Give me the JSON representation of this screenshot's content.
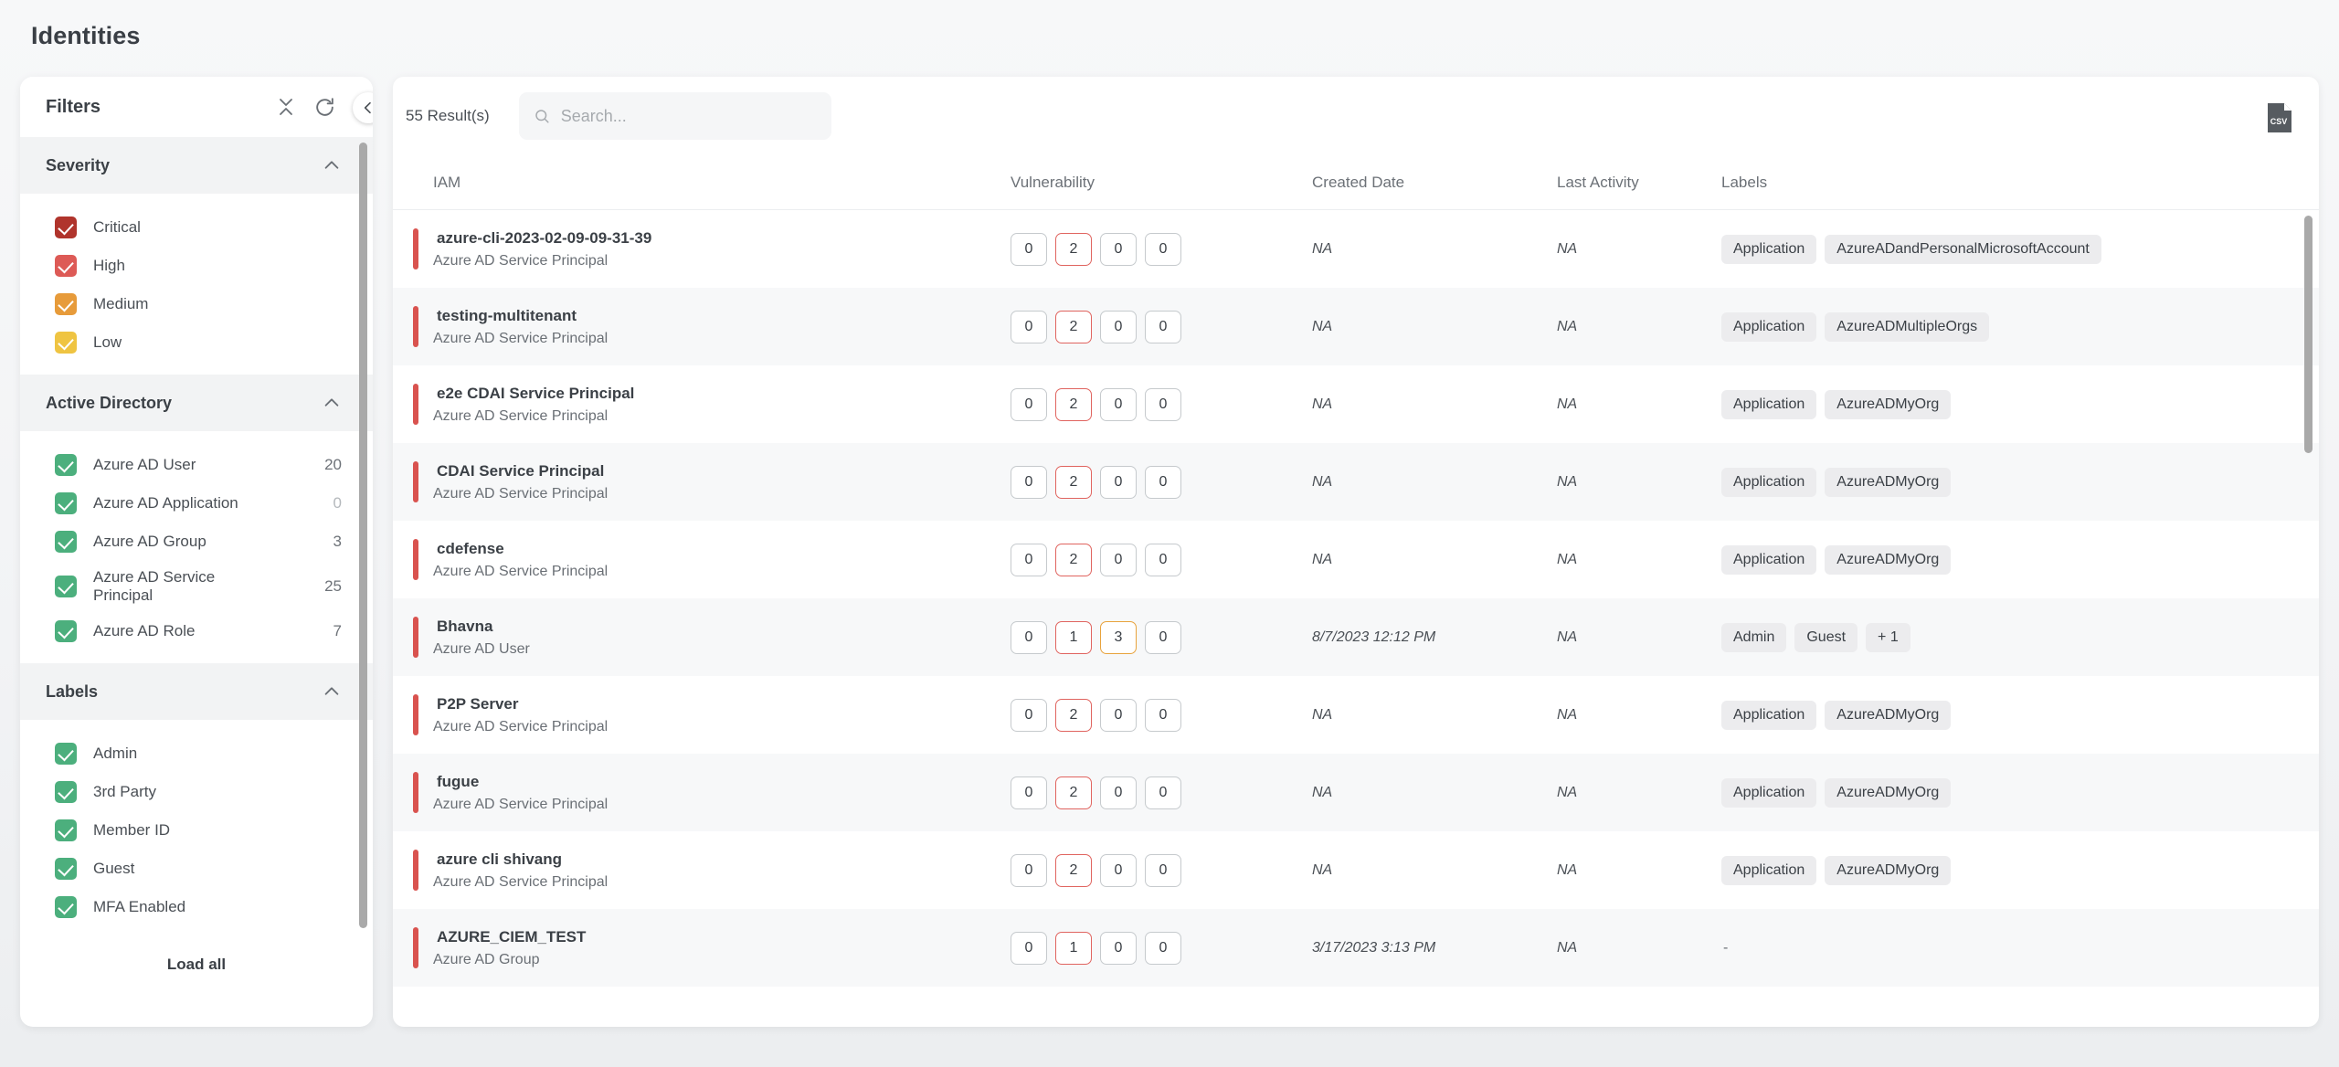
{
  "page": {
    "title": "Identities"
  },
  "sidebar": {
    "title": "Filters",
    "icons": {
      "collapse_all": "collapse-all-icon",
      "reset": "refresh-icon",
      "panel_toggle": "chevron-left-icon"
    },
    "load_all_label": "Load all",
    "groups": [
      {
        "name": "Severity",
        "items": [
          {
            "label": "Critical",
            "color": "#b0342c",
            "checked": true,
            "count": ""
          },
          {
            "label": "High",
            "color": "#dd5a56",
            "checked": true,
            "count": ""
          },
          {
            "label": "Medium",
            "color": "#e79b3a",
            "checked": true,
            "count": ""
          },
          {
            "label": "Low",
            "color": "#efc442",
            "checked": true,
            "count": ""
          }
        ]
      },
      {
        "name": "Active Directory",
        "items": [
          {
            "label": "Azure AD User",
            "color": "#4caf7d",
            "checked": true,
            "count": "20"
          },
          {
            "label": "Azure AD Application",
            "color": "#4caf7d",
            "checked": true,
            "count": "0"
          },
          {
            "label": "Azure AD Group",
            "color": "#4caf7d",
            "checked": true,
            "count": "3"
          },
          {
            "label": "Azure AD Service Principal",
            "color": "#4caf7d",
            "checked": true,
            "count": "25"
          },
          {
            "label": "Azure AD Role",
            "color": "#4caf7d",
            "checked": true,
            "count": "7"
          }
        ]
      },
      {
        "name": "Labels",
        "items": [
          {
            "label": "Admin",
            "color": "#4caf7d",
            "checked": true,
            "count": ""
          },
          {
            "label": "3rd Party",
            "color": "#4caf7d",
            "checked": true,
            "count": ""
          },
          {
            "label": "Member ID",
            "color": "#4caf7d",
            "checked": true,
            "count": ""
          },
          {
            "label": "Guest",
            "color": "#4caf7d",
            "checked": true,
            "count": ""
          },
          {
            "label": "MFA Enabled",
            "color": "#4caf7d",
            "checked": true,
            "count": ""
          }
        ]
      }
    ]
  },
  "main": {
    "results_label": "55 Result(s)",
    "search": {
      "value": "",
      "placeholder": "Search..."
    },
    "export_icon": "csv-file-icon",
    "columns": [
      "IAM",
      "Vulnerability",
      "Created Date",
      "Last Activity",
      "Labels"
    ],
    "rows": [
      {
        "name": "azure-cli-2023-02-09-09-31-39",
        "type": "Azure AD Service Principal",
        "severity_color": "#d9534f",
        "vulnerabilities": [
          {
            "value": "0",
            "level": "none"
          },
          {
            "value": "2",
            "level": "high"
          },
          {
            "value": "0",
            "level": "none"
          },
          {
            "value": "0",
            "level": "none"
          }
        ],
        "created_date": "NA",
        "last_activity": "NA",
        "labels": [
          "Application",
          "AzureADandPersonalMicrosoftAccount"
        ]
      },
      {
        "name": "testing-multitenant",
        "type": "Azure AD Service Principal",
        "severity_color": "#d9534f",
        "vulnerabilities": [
          {
            "value": "0",
            "level": "none"
          },
          {
            "value": "2",
            "level": "high"
          },
          {
            "value": "0",
            "level": "none"
          },
          {
            "value": "0",
            "level": "none"
          }
        ],
        "created_date": "NA",
        "last_activity": "NA",
        "labels": [
          "Application",
          "AzureADMultipleOrgs"
        ]
      },
      {
        "name": "e2e CDAI Service Principal",
        "type": "Azure AD Service Principal",
        "severity_color": "#d9534f",
        "vulnerabilities": [
          {
            "value": "0",
            "level": "none"
          },
          {
            "value": "2",
            "level": "high"
          },
          {
            "value": "0",
            "level": "none"
          },
          {
            "value": "0",
            "level": "none"
          }
        ],
        "created_date": "NA",
        "last_activity": "NA",
        "labels": [
          "Application",
          "AzureADMyOrg"
        ]
      },
      {
        "name": "CDAI Service Principal",
        "type": "Azure AD Service Principal",
        "severity_color": "#d9534f",
        "vulnerabilities": [
          {
            "value": "0",
            "level": "none"
          },
          {
            "value": "2",
            "level": "high"
          },
          {
            "value": "0",
            "level": "none"
          },
          {
            "value": "0",
            "level": "none"
          }
        ],
        "created_date": "NA",
        "last_activity": "NA",
        "labels": [
          "Application",
          "AzureADMyOrg"
        ]
      },
      {
        "name": "cdefense",
        "type": "Azure AD Service Principal",
        "severity_color": "#d9534f",
        "vulnerabilities": [
          {
            "value": "0",
            "level": "none"
          },
          {
            "value": "2",
            "level": "high"
          },
          {
            "value": "0",
            "level": "none"
          },
          {
            "value": "0",
            "level": "none"
          }
        ],
        "created_date": "NA",
        "last_activity": "NA",
        "labels": [
          "Application",
          "AzureADMyOrg"
        ]
      },
      {
        "name": "Bhavna",
        "type": "Azure AD User",
        "severity_color": "#d9534f",
        "vulnerabilities": [
          {
            "value": "0",
            "level": "none"
          },
          {
            "value": "1",
            "level": "high"
          },
          {
            "value": "3",
            "level": "medium"
          },
          {
            "value": "0",
            "level": "none"
          }
        ],
        "created_date": "8/7/2023 12:12 PM",
        "last_activity": "NA",
        "labels": [
          "Admin",
          "Guest",
          "+ 1"
        ]
      },
      {
        "name": "P2P Server",
        "type": "Azure AD Service Principal",
        "severity_color": "#d9534f",
        "vulnerabilities": [
          {
            "value": "0",
            "level": "none"
          },
          {
            "value": "2",
            "level": "high"
          },
          {
            "value": "0",
            "level": "none"
          },
          {
            "value": "0",
            "level": "none"
          }
        ],
        "created_date": "NA",
        "last_activity": "NA",
        "labels": [
          "Application",
          "AzureADMyOrg"
        ]
      },
      {
        "name": "fugue",
        "type": "Azure AD Service Principal",
        "severity_color": "#d9534f",
        "vulnerabilities": [
          {
            "value": "0",
            "level": "none"
          },
          {
            "value": "2",
            "level": "high"
          },
          {
            "value": "0",
            "level": "none"
          },
          {
            "value": "0",
            "level": "none"
          }
        ],
        "created_date": "NA",
        "last_activity": "NA",
        "labels": [
          "Application",
          "AzureADMyOrg"
        ]
      },
      {
        "name": "azure cli shivang",
        "type": "Azure AD Service Principal",
        "severity_color": "#d9534f",
        "vulnerabilities": [
          {
            "value": "0",
            "level": "none"
          },
          {
            "value": "2",
            "level": "high"
          },
          {
            "value": "0",
            "level": "none"
          },
          {
            "value": "0",
            "level": "none"
          }
        ],
        "created_date": "NA",
        "last_activity": "NA",
        "labels": [
          "Application",
          "AzureADMyOrg"
        ]
      },
      {
        "name": "AZURE_CIEM_TEST",
        "type": "Azure AD Group",
        "severity_color": "#d9534f",
        "vulnerabilities": [
          {
            "value": "0",
            "level": "none"
          },
          {
            "value": "1",
            "level": "high"
          },
          {
            "value": "0",
            "level": "none"
          },
          {
            "value": "0",
            "level": "none"
          }
        ],
        "created_date": "3/17/2023 3:13 PM",
        "last_activity": "NA",
        "labels": [
          "-"
        ]
      }
    ]
  }
}
